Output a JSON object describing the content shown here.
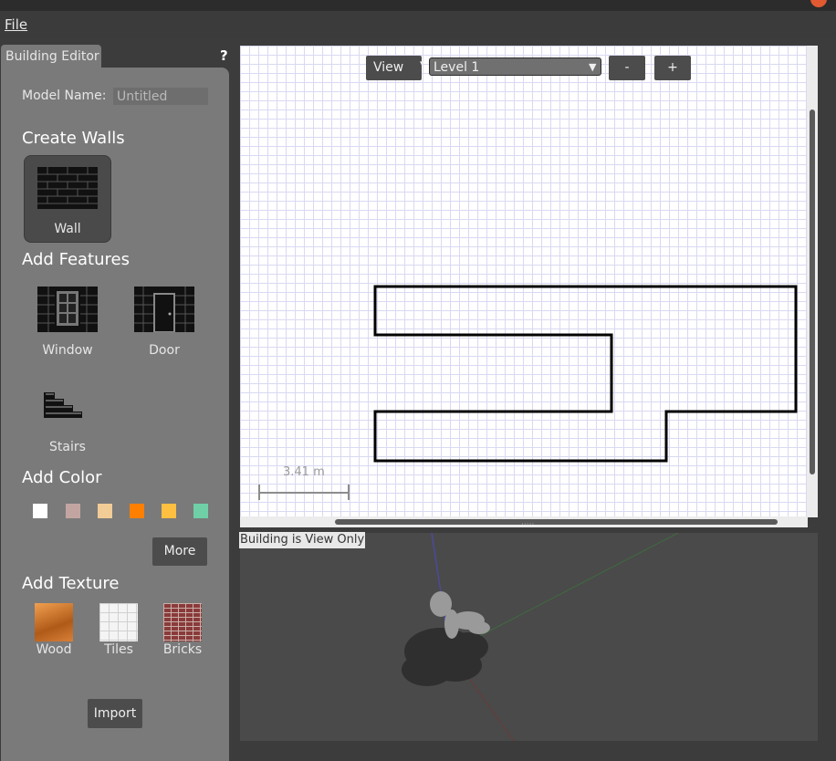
{
  "menu": {
    "file": "File"
  },
  "panel": {
    "tab": "Building Editor",
    "help": "?",
    "model_name_label": "Model Name:",
    "model_name_value": "Untitled",
    "create_walls": "Create Walls",
    "wall": "Wall",
    "add_features": "Add Features",
    "window": "Window",
    "door": "Door",
    "stairs": "Stairs",
    "add_color": "Add Color",
    "colors": [
      "#ffffff",
      "#c2a5a0",
      "#f2cc96",
      "#ff8000",
      "#ffbf40",
      "#6fd0a8"
    ],
    "more": "More",
    "add_texture": "Add Texture",
    "wood": "Wood",
    "tiles": "Tiles",
    "bricks": "Bricks",
    "import": "Import"
  },
  "editor": {
    "view": "View",
    "level": "Level 1",
    "minus": "-",
    "plus": "+",
    "scale": "3.41 m",
    "status": "Building is View Only"
  }
}
